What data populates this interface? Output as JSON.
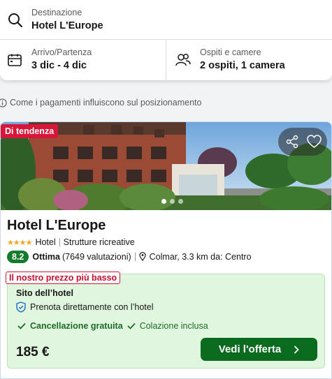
{
  "search": {
    "destination_label": "Destinazione",
    "destination_value": "Hotel L'Europe",
    "dates_label": "Arrivo/Partenza",
    "dates_value": "3 dic - 4 dic",
    "guests_label": "Ospiti e camere",
    "guests_value": "2 ospiti, 1 camera"
  },
  "ranking_info": "Come i pagamenti influiscono sul posizionamento",
  "hotel": {
    "badge": "Di tendenza",
    "name": "Hotel L'Europe",
    "stars": 4,
    "type": "Hotel",
    "category": "Strutture ricreative",
    "score": "8.2",
    "score_label": "Ottima",
    "reviews": "(7649 valutazioni)",
    "location": "Colmar, 3.3 km da: Centro",
    "photo_index": 1,
    "photo_count": 3
  },
  "deal": {
    "label": "Il nostro prezzo più basso",
    "site": "Sito dell’hotel",
    "direct": "Prenota direttamente con l’hotel",
    "perk1": "Cancellazione gratuita",
    "perk2": "Colazione inclusa",
    "price": "185 €",
    "cta": "Vedi l'offerta"
  },
  "colors": {
    "badge_red": "#d8163a",
    "score_green": "#147a2c",
    "cta_green": "#0a6a1d",
    "deal_bg": "#e0f6de"
  }
}
